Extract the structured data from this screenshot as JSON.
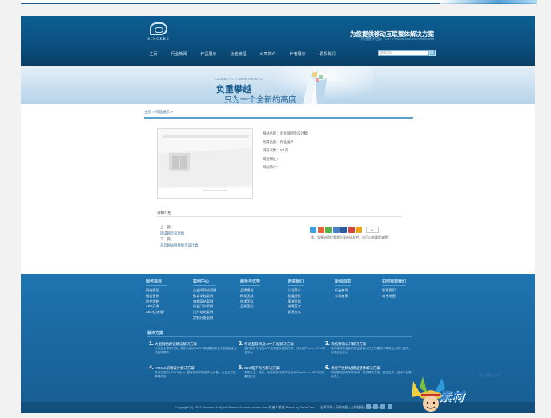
{
  "header": {
    "logo_text": "SINCERE",
    "slogan": "为您提供移动互联整体解决方案",
    "hotline": "热线技术团队 | 0571-86488188 400-5686-998",
    "search_placeholder": "搜索项目",
    "nav": [
      "主页",
      "行业新闻",
      "作品展示",
      "功能流程",
      "公司简介",
      "作者展示",
      "联系我们"
    ]
  },
  "banner": {
    "tag": "CLIMB TO A NEW HEIGHT",
    "title": "负重攀越",
    "subtitle": "只为一个全新的高度"
  },
  "breadcrumb": "主页 > 作品展示 >",
  "project": {
    "meta": [
      "网站名称：企业网网页设计稿",
      "所属类别：作品展示",
      "浏览次数：67 次",
      "简短网址：",
      "网站简介："
    ],
    "detail_title": "详细介绍",
    "prev_label": "上一篇：",
    "prev_link": "搓澡网页设计稿",
    "next_label": "下一篇：",
    "next_link": "海云网站链接网页设计稿",
    "share_count": "0",
    "share_note": "哦，如果觉得好看就分享给好友吧，也可以收藏起来哦！"
  },
  "footer": {
    "columns": [
      {
        "title": "服务项目",
        "links": [
          "网站建设",
          "微信营销",
          "软件定制",
          "APP开发",
          "SEO优化推广"
        ]
      },
      {
        "title": "案例中心",
        "links": [
          "企业网网站案例",
          "教育学校案例",
          "电商网站案例",
          "行业门户案例",
          "门户站站案例",
          "定制开发案例"
        ]
      },
      {
        "title": "服务与优势",
        "links": [
          "品牌建设",
          "研发团队",
          "技术团队",
          "品质团队"
        ]
      },
      {
        "title": "走进我们",
        "links": [
          "公司简介",
          "发展历程",
          "荣誉资质",
          "诚聘英才",
          "联系方式"
        ]
      },
      {
        "title": "新闻动态",
        "links": [
          "行业新闻",
          "公司新闻"
        ]
      },
      {
        "title": "如何找到我们",
        "links": [
          "联系我们",
          "电子地图"
        ]
      }
    ],
    "solutions_title": "解决方案",
    "solutions": [
      {
        "num": "1.",
        "title": "大型网站建设建设解决方案",
        "desc": "针对企业需求打造，提供大量从BA2C网站建设解决方案满足企业的各种需求"
      },
      {
        "num": "2.",
        "title": "移动互联网及APP开发解决方案",
        "desc": "我们提供专业的APP应用程序定制开发，涉及到iPhone、iPad等多平台"
      },
      {
        "num": "3.",
        "title": "微信营销公开解决方案",
        "desc": "各领域精准营销的微信营销公开工作建设中帮助企业的二维码，实现企业收入"
      },
      {
        "num": "4.",
        "title": "HTML5前端设计解决方案",
        "desc": "采用先进的HTML5技术，兼容多种浏览器平台设备，为企业打造卓越体验"
      },
      {
        "num": "5.",
        "title": "B2C电子商务解决方案",
        "desc": "采用安全、稳定、功能强的电商平台技术ShopServer B2C系统，高效打造"
      },
      {
        "num": "6.",
        "title": "教育学校网站建设整体解决方案",
        "desc": "网站建设服务学校使用一站式解决方案，建立在统一技术平台基础之上"
      }
    ],
    "copyright": "Copyright (c) 2012 Sincere All Rights Reserved.www.sincere.com 作者人都由 Power by DedeCms",
    "bottom_links": "法律声明 | 网站地图 | 友情链接 | dedecms模板"
  },
  "watermark": {
    "small": "专注素材分享",
    "main": "素材"
  },
  "colors": {
    "header_blue": "#0b4f7e",
    "footer_blue": "#1b69a3",
    "accent_line": "#5aa0d0"
  }
}
